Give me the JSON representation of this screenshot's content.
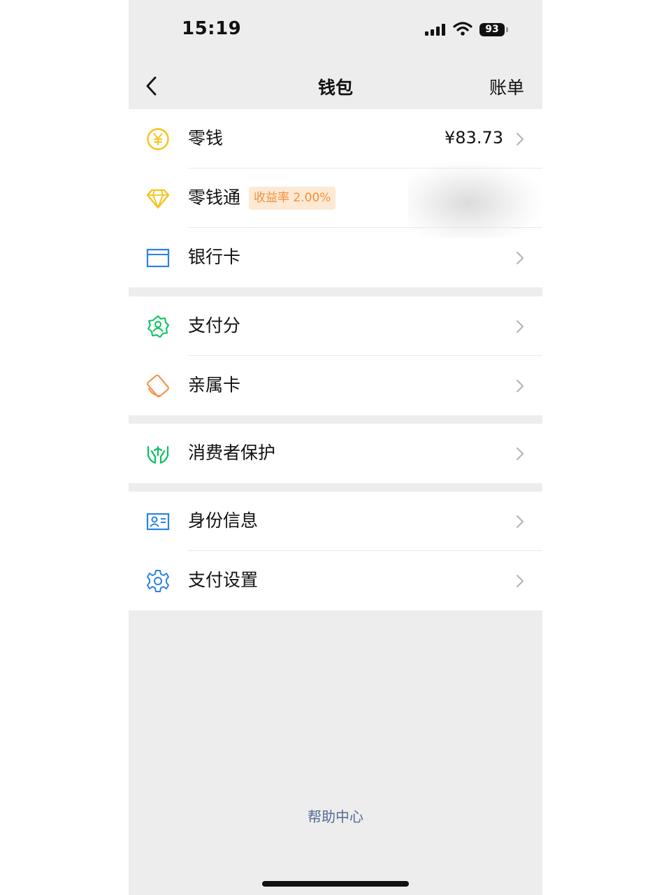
{
  "status_bar": {
    "time": "15:19",
    "battery": "93"
  },
  "nav": {
    "title": "钱包",
    "bill": "账单"
  },
  "wallet": {
    "balance": {
      "label": "零钱",
      "value": "¥83.73"
    },
    "lingqiantong": {
      "label": "零钱通",
      "badge": "收益率 2.00%"
    },
    "bank_card": {
      "label": "银行卡"
    }
  },
  "services": {
    "pay_score": "支付分",
    "family_card": "亲属卡"
  },
  "protection": {
    "consumer_protection": "消费者保护"
  },
  "settings": {
    "identity": "身份信息",
    "pay_settings": "支付设置"
  },
  "footer": {
    "help_center": "帮助中心"
  },
  "colors": {
    "balance": "#f7c21b",
    "gem": "#f7c21b",
    "bank": "#2b82e4",
    "green": "#07c160",
    "orange": "#f5934a",
    "link": "#576b95"
  },
  "icons": [
    "yuan-coin-icon",
    "diamond-icon",
    "bank-card-icon",
    "pay-score-icon",
    "family-card-icon",
    "consumer-protection-icon",
    "id-card-icon",
    "gear-icon",
    "chevron-right-icon",
    "back-arrow-icon"
  ]
}
